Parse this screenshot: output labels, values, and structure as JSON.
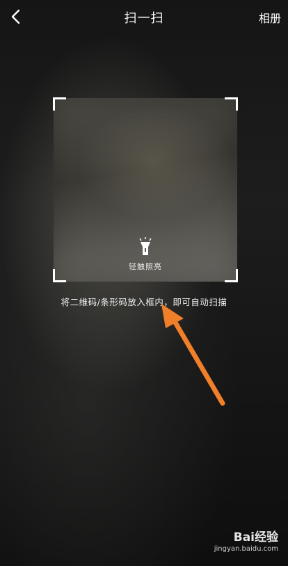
{
  "header": {
    "title": "扫一扫",
    "album_label": "相册"
  },
  "scanner": {
    "torch_label": "轻触照亮",
    "hint": "将二维码/条形码放入框内，即可自动扫描"
  },
  "watermark": {
    "logo_text": "Bai经验",
    "url": "jingyan.baidu.com"
  },
  "colors": {
    "annotation_arrow": "#f07f2a"
  }
}
